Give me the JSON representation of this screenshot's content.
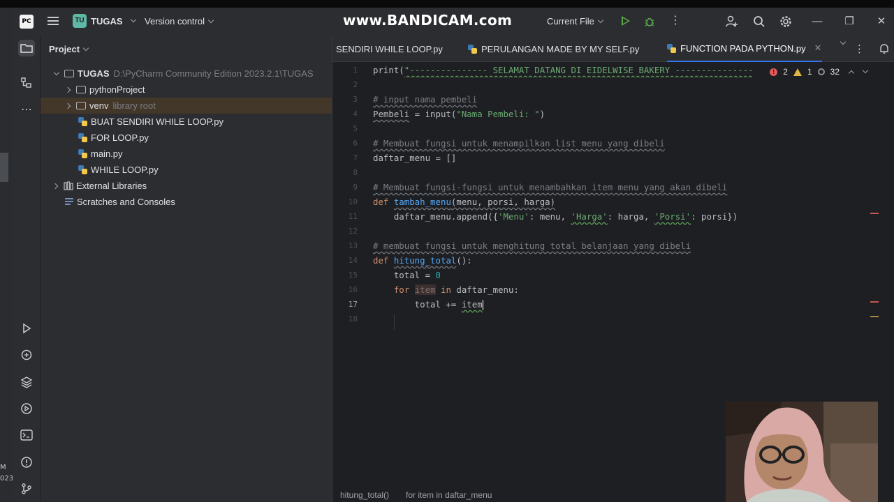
{
  "watermark": "www.BANDICAM.com",
  "titlebar": {
    "logo": "PC",
    "project_badge": "TU",
    "project_name": "TUGAS",
    "vcs_label": "Version control",
    "run_config": "Current File"
  },
  "left_edge_text": [
    "M",
    "023"
  ],
  "project_panel": {
    "title": "Project",
    "root": {
      "name": "TUGAS",
      "path": "D:\\PyCharm Community Edition 2023.2.1\\TUGAS"
    },
    "items": [
      {
        "label": "pythonProject",
        "type": "folder"
      },
      {
        "label": "venv",
        "hint": "library root",
        "type": "folder"
      },
      {
        "label": "BUAT SENDIRI WHILE LOOP.py",
        "type": "py"
      },
      {
        "label": "FOR LOOP.py",
        "type": "py"
      },
      {
        "label": "main.py",
        "type": "py"
      },
      {
        "label": "WHILE LOOP.py",
        "type": "py"
      }
    ],
    "external": "External Libraries",
    "scratches": "Scratches and Consoles"
  },
  "tabs": [
    {
      "label": "SENDIRI WHILE LOOP.py",
      "active": false
    },
    {
      "label": "PERULANGAN MADE BY MY SELF.py",
      "active": false
    },
    {
      "label": "FUNCTION PADA PYTHON.py",
      "active": true
    }
  ],
  "inspections": {
    "errors": "2",
    "warnings": "1",
    "weak": "32"
  },
  "code": {
    "current_line": 17,
    "line_numbers": [
      "1",
      "2",
      "3",
      "4",
      "5",
      "6",
      "7",
      "8",
      "9",
      "10",
      "11",
      "12",
      "13",
      "14",
      "15",
      "16",
      "17",
      "18"
    ],
    "l1_a": "print(",
    "l1_b": "\"--------------- SELAMAT DATANG DI EIDELWISE BAKERY ---------------",
    "l3": "# input nama pembeli",
    "l4_a": "Pembeli",
    "l4_b": " = input(",
    "l4_c": "\"Nama Pembeli: \"",
    "l4_d": ")",
    "l6": "# Membuat fungsi untuk menampilkan list menu yang dibeli",
    "l7": "daftar_menu = []",
    "l9": "# Membuat fungsi-fungsi untuk menambahkan item menu yang akan dibeli",
    "l10_kw": "def ",
    "l10_fn": "tambah_menu",
    "l10_rest": "(menu, porsi, harga)",
    "l11_a": "    daftar_menu.append({",
    "l11_b": "'Menu'",
    "l11_c": ": menu, ",
    "l11_d": "'Harga'",
    "l11_e": ": harga, ",
    "l11_f": "'Porsi'",
    "l11_g": ": porsi})",
    "l13": "# membuat fungsi untuk menghitung total belanjaan yang dibeli",
    "l14_kw": "def ",
    "l14_fn": "hitung_total",
    "l14_rest": "():",
    "l15_a": "    total = ",
    "l15_b": "0",
    "l16_a": "    for ",
    "l16_b": "item",
    "l16_c": " in ",
    "l16_d": "daftar_menu:",
    "l17_a": "        total += ",
    "l17_b": "item"
  },
  "breadcrumb": [
    "hitung_total()",
    "for item in daftar_menu"
  ],
  "colors": {
    "accent": "#3574f0",
    "error": "#e55b5b",
    "warning": "#e0b542",
    "selection": "#43372a"
  },
  "icons": {
    "toolstrip": [
      "folder-icon",
      "structure-icon",
      "more-icon",
      "run-icon",
      "python-console-icon",
      "layers-icon",
      "services-icon",
      "terminal-icon",
      "problems-icon",
      "git-icon"
    ],
    "titlebar": [
      "run-icon",
      "debug-icon",
      "more-icon",
      "add-user-icon",
      "search-icon",
      "settings-icon",
      "minimize-icon",
      "restore-icon",
      "close-icon"
    ]
  }
}
